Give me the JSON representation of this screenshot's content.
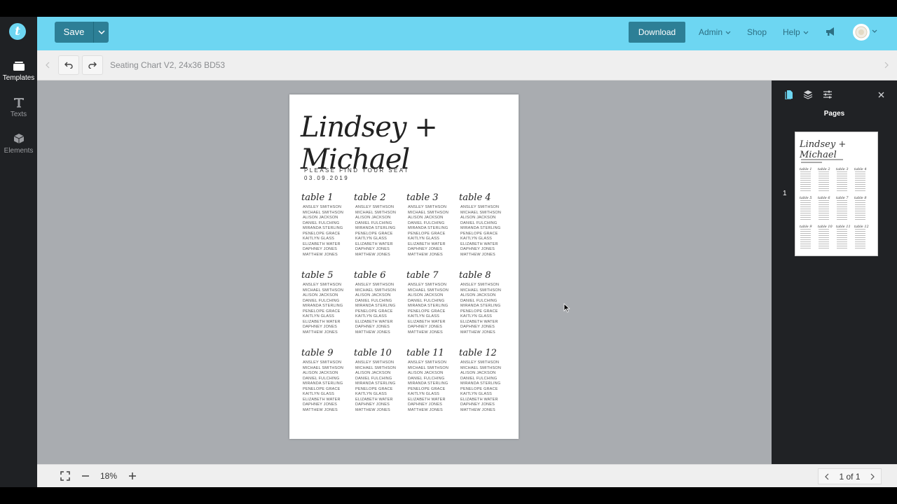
{
  "header": {
    "save_label": "Save",
    "download_label": "Download",
    "nav": [
      "Admin",
      "Shop",
      "Help"
    ]
  },
  "sidebar": {
    "items": [
      {
        "label": "Templates",
        "icon": "templates-icon"
      },
      {
        "label": "Texts",
        "icon": "text-icon"
      },
      {
        "label": "Elements",
        "icon": "elements-icon"
      }
    ]
  },
  "toolbar": {
    "document_title": "Seating Chart V2, 24x36 BD53"
  },
  "design": {
    "names": "Lindsey + Michael",
    "subtitle": "PLEASE FIND YOUR SEAT",
    "date": "03.09.2019",
    "tables": [
      {
        "name": "table 1"
      },
      {
        "name": "table 2"
      },
      {
        "name": "table 3"
      },
      {
        "name": "table 4"
      },
      {
        "name": "table 5"
      },
      {
        "name": "table 6"
      },
      {
        "name": "table 7"
      },
      {
        "name": "table 8"
      },
      {
        "name": "table 9"
      },
      {
        "name": "table 10"
      },
      {
        "name": "table 11"
      },
      {
        "name": "table 12"
      }
    ],
    "guests": [
      "ANSLEY SMITHSON",
      "MICHAEL SMITHSON",
      "ALISON JACKSON",
      "DANIEL FULCHING",
      "MIRANDA STERLING",
      "PENELOPE GRACE",
      "KAITLYN GLASS",
      "ELIZABETH WATER",
      "DAPHNEY JONES",
      "MATTHEW JONES"
    ]
  },
  "right_panel": {
    "title": "Pages",
    "page_number": "1"
  },
  "bottom": {
    "zoom": "18%",
    "pager": "1 of 1"
  },
  "colors": {
    "topbar": "#6dd6f2",
    "button": "#2d7f96",
    "dark": "#1f2124",
    "canvas": "#a9acb0"
  }
}
